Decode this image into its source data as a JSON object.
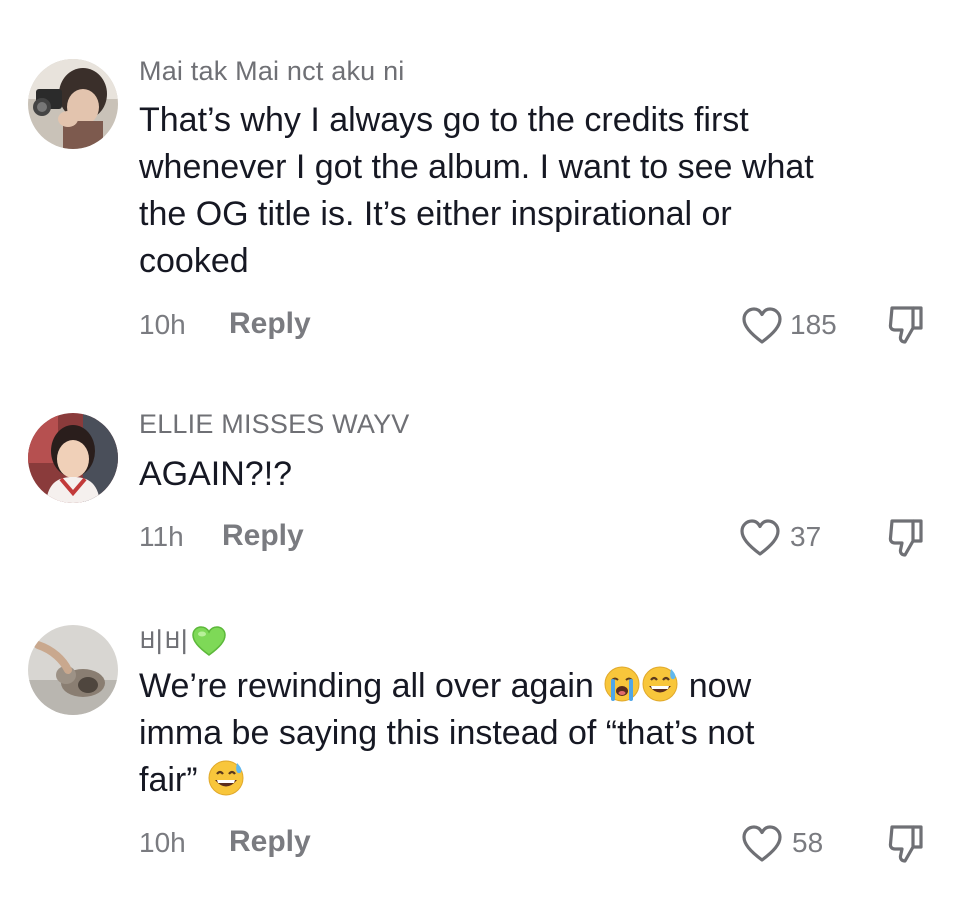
{
  "comments": [
    {
      "username": "Mai tak Mai nct aku ni",
      "text_lines": [
        "That’s why I always go to the credits first",
        "whenever I got the album. I want to see what",
        "the OG title is. It’s either inspirational or",
        "cooked"
      ],
      "time": "10h",
      "reply_label": "Reply",
      "likes": "185"
    },
    {
      "username": "ELLIE MISSES WAYV",
      "text_lines": [
        "AGAIN?!?"
      ],
      "time": "11h",
      "reply_label": "Reply",
      "likes": "37"
    },
    {
      "username": "비비",
      "username_emoji": "green-heart-emoji",
      "text_part1": "We’re rewinding all over again",
      "text_emoji1": "loudly-crying-face-emoji",
      "text_emoji2": "grinning-sweat-face-emoji",
      "text_part2": " now",
      "text_line2": "imma be saying this instead of “that’s not",
      "text_line3": "fair”",
      "text_emoji3": "grinning-sweat-face-emoji",
      "time": "10h",
      "reply_label": "Reply",
      "likes": "58"
    }
  ],
  "icons": {
    "like": "heart-outline-icon",
    "dislike": "thumbs-down-icon"
  },
  "colors": {
    "text_primary": "#161823",
    "text_secondary": "#7a7b80",
    "green_heart": "#7ed957",
    "emoji_yellow": "#f8c63b"
  }
}
